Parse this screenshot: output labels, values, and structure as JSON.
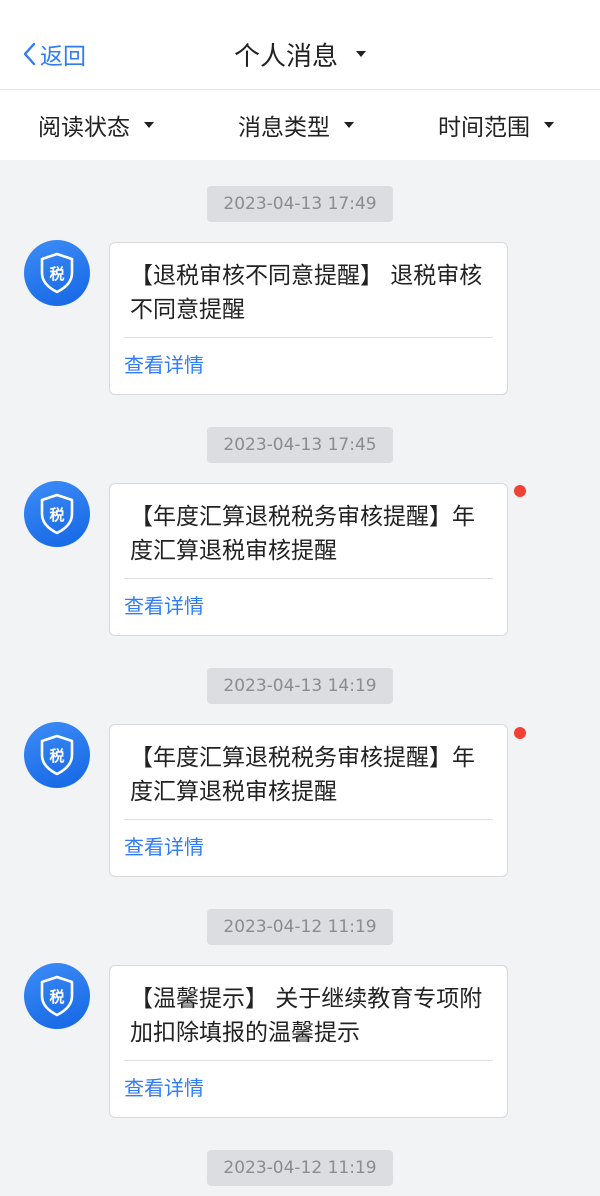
{
  "header": {
    "back_label": "返回",
    "title": "个人消息"
  },
  "filters": {
    "read_status": "阅读状态",
    "message_type": "消息类型",
    "time_range": "时间范围"
  },
  "messages": [
    {
      "timestamp": "2023-04-13 17:49",
      "text": "【退税审核不同意提醒】 退税审核不同意提醒",
      "link": "查看详情",
      "unread": false
    },
    {
      "timestamp": "2023-04-13 17:45",
      "text": "【年度汇算退税税务审核提醒】年度汇算退税审核提醒",
      "link": "查看详情",
      "unread": true
    },
    {
      "timestamp": "2023-04-13 14:19",
      "text": "【年度汇算退税税务审核提醒】年度汇算退税审核提醒",
      "link": "查看详情",
      "unread": true
    },
    {
      "timestamp": "2023-04-12 11:19",
      "text": "【温馨提示】 关于继续教育专项附加扣除填报的温馨提示",
      "link": "查看详情",
      "unread": false
    },
    {
      "timestamp": "2023-04-12 11:19"
    }
  ],
  "avatar_badge": "税",
  "colors": {
    "accent": "#2f7cf6",
    "unread_dot": "#f04134",
    "background": "#f2f3f5"
  }
}
